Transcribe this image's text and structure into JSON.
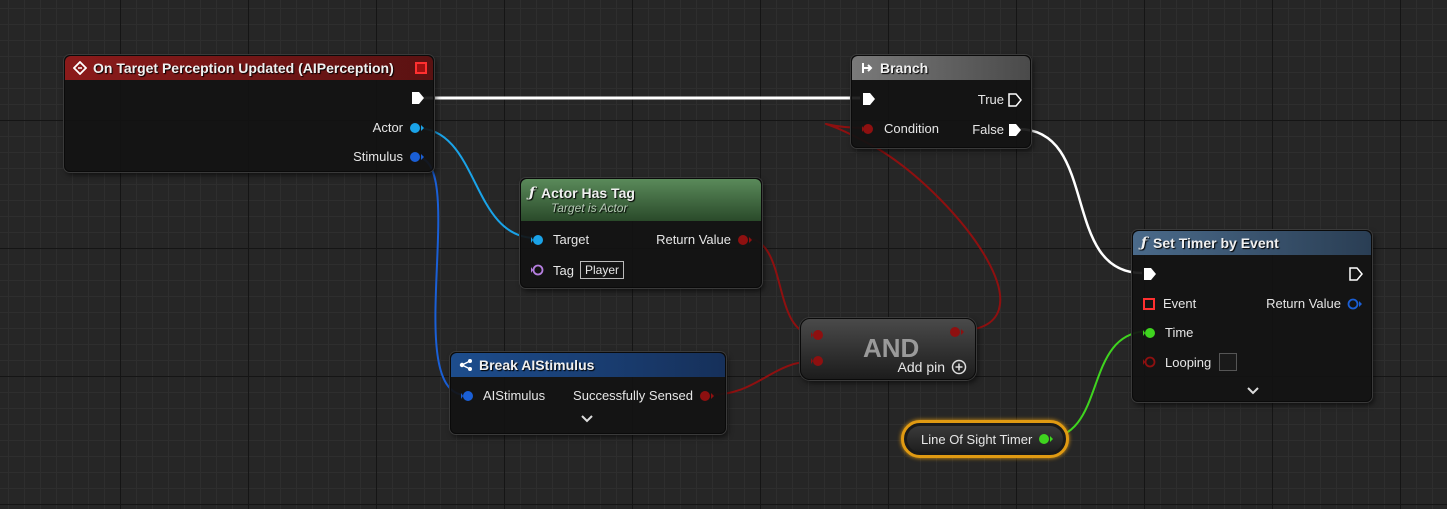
{
  "event_node": {
    "title": "On Target Perception Updated (AIPerception)",
    "pin_actor": "Actor",
    "pin_stimulus": "Stimulus",
    "header_color": "#8b1a1a"
  },
  "branch_node": {
    "title": "Branch",
    "pin_condition": "Condition",
    "pin_true": "True",
    "pin_false": "False"
  },
  "has_tag_node": {
    "title": "Actor Has Tag",
    "subtitle": "Target is Actor",
    "pin_target": "Target",
    "pin_tag": "Tag",
    "tag_value": "Player",
    "pin_return": "Return Value"
  },
  "break_node": {
    "title": "Break AIStimulus",
    "pin_in": "AIStimulus",
    "pin_out": "Successfully Sensed"
  },
  "and_node": {
    "title": "AND",
    "add_pin": "Add pin"
  },
  "timer_node": {
    "title": "Set Timer by Event",
    "pin_event": "Event",
    "pin_time": "Time",
    "pin_looping": "Looping",
    "pin_return": "Return Value"
  },
  "variable_node": {
    "label": "Line Of Sight Timer"
  },
  "colors": {
    "exec": "#ffffff",
    "object": "#1aa3e8",
    "struct": "#1a5fd6",
    "bool": "#8e1010",
    "float": "#3fd41f",
    "name": "#b67fe0",
    "delegate": "#ff3030"
  }
}
